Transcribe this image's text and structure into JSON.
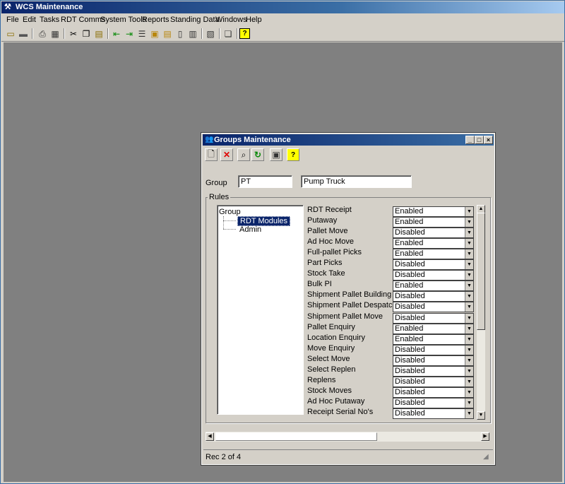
{
  "app": {
    "title": "WCS Maintenance"
  },
  "menu": [
    "File",
    "Edit",
    "Tasks",
    "RDT Comms",
    "System Tools",
    "Reports",
    "Standing Data",
    "Windows",
    "Help"
  ],
  "toolbar_icons": [
    "open-icon",
    "save-icon",
    "print-icon",
    "calculator-icon",
    "cut-icon",
    "copy-icon",
    "paste-icon",
    "move-left-icon",
    "move-right-icon",
    "list-icon",
    "package-icon",
    "package-open-icon",
    "lock-icon",
    "tools-icon",
    "help-icon"
  ],
  "dialog": {
    "title": "Groups Maintenance",
    "toolbar_icons": [
      "new-icon",
      "delete-icon",
      "search-icon",
      "refresh-icon",
      "save-icon",
      "help-icon"
    ],
    "group_label": "Group",
    "group_code": "PT",
    "group_name": "Pump Truck",
    "rules_label": "Rules",
    "tree": {
      "root": "Group",
      "children": [
        "RDT Modules",
        "Admin"
      ],
      "selected": "RDT Modules"
    },
    "rules": [
      {
        "name": "RDT Receipt",
        "value": "Enabled"
      },
      {
        "name": "Putaway",
        "value": "Enabled"
      },
      {
        "name": "Pallet Move",
        "value": "Disabled"
      },
      {
        "name": "Ad Hoc Move",
        "value": "Enabled"
      },
      {
        "name": "Full-pallet Picks",
        "value": "Enabled"
      },
      {
        "name": "Part Picks",
        "value": "Disabled"
      },
      {
        "name": "Stock Take",
        "value": "Disabled"
      },
      {
        "name": "Bulk PI",
        "value": "Enabled"
      },
      {
        "name": "Shipment Pallet Building",
        "value": "Disabled"
      },
      {
        "name": "Shipment Pallet Despatch",
        "value": "Disabled"
      },
      {
        "name": "Shipment Pallet Move",
        "value": "Disabled"
      },
      {
        "name": "Pallet Enquiry",
        "value": "Enabled"
      },
      {
        "name": "Location Enquiry",
        "value": "Enabled"
      },
      {
        "name": "Move Enquiry",
        "value": "Disabled"
      },
      {
        "name": "Select Move",
        "value": "Disabled"
      },
      {
        "name": "Select Replen",
        "value": "Disabled"
      },
      {
        "name": "Replens",
        "value": "Disabled"
      },
      {
        "name": "Stock Moves",
        "value": "Disabled"
      },
      {
        "name": "Ad Hoc Putaway",
        "value": "Disabled"
      },
      {
        "name": "Receipt Serial No's",
        "value": "Disabled"
      }
    ],
    "status": "Rec 2 of 4"
  }
}
